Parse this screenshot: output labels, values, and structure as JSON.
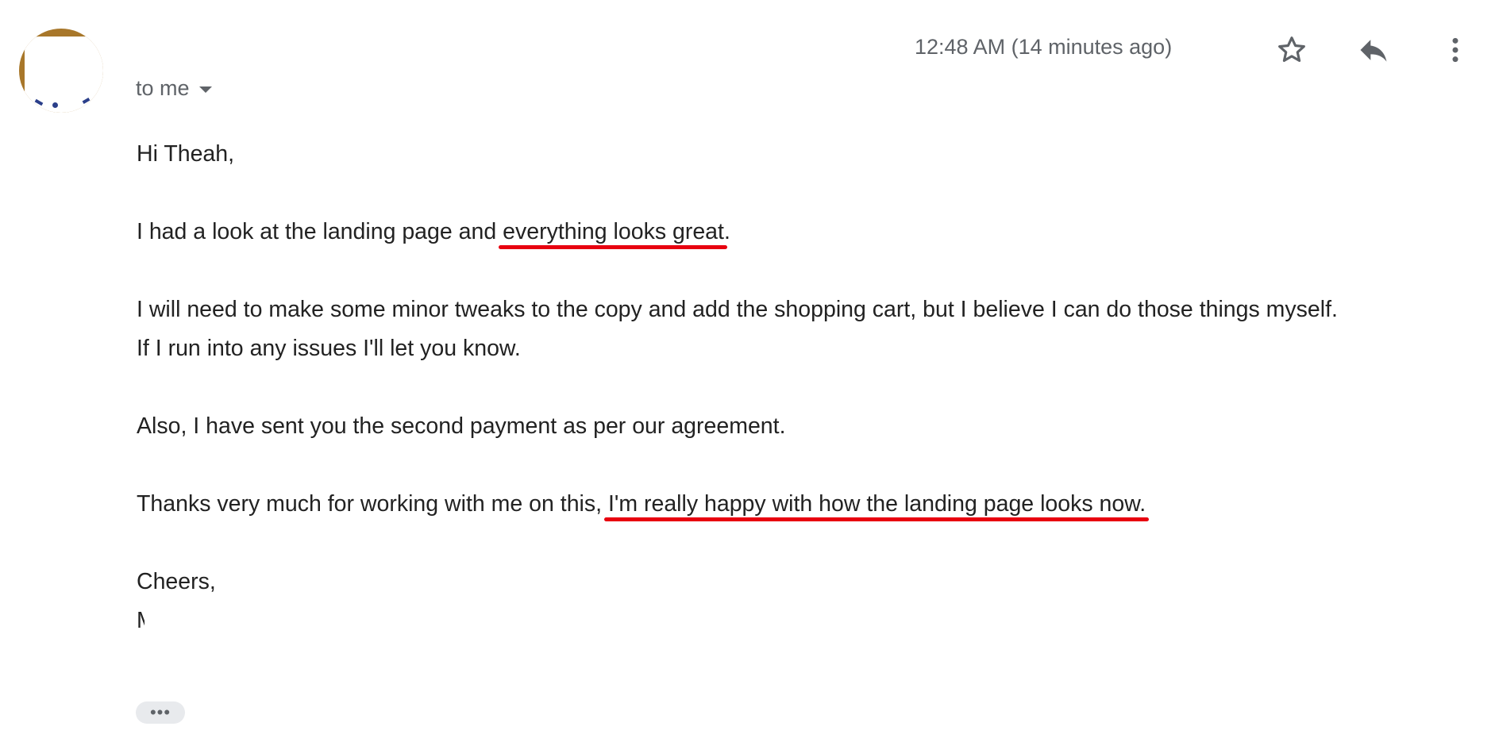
{
  "message": {
    "recipient_label": "to me",
    "timestamp": "12:48 AM (14 minutes ago)",
    "icons": {
      "star": "star-icon",
      "reply": "reply-icon",
      "more": "more-vert-icon",
      "recipients_toggle": "caret-down-icon"
    },
    "body": {
      "greeting": "Hi Theah,",
      "para1_before": "I had a look at the landing page and ",
      "para1_highlight": "everything looks great",
      "para1_after": ".",
      "para2_line1": "I will need to make some minor tweaks to the copy and add the shopping cart, but I believe I can do those things myself.",
      "para2_line2": "If I run into any issues I'll let you know.",
      "para3": "Also, I have sent you the second payment as per our agreement.",
      "para4_before": "Thanks very much for working with me on this, ",
      "para4_highlight": "I'm really happy with how the landing page looks now.",
      "signoff": "Cheers,",
      "signature_initial": "M"
    },
    "show_trimmed_label": "•••",
    "highlight_color": "#e8000f"
  }
}
